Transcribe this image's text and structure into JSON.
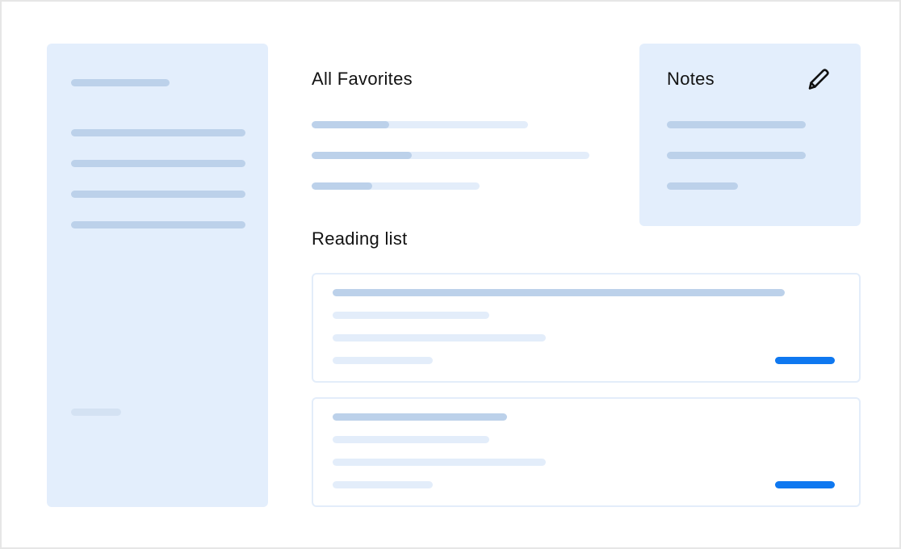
{
  "favorites": {
    "title": "All Favorites",
    "items": [
      {
        "progress": 0.36
      },
      {
        "progress": 0.36
      },
      {
        "progress": 0.36
      }
    ]
  },
  "reading_list": {
    "title": "Reading list"
  },
  "notes": {
    "title": "Notes",
    "edit_icon": "pencil-icon"
  },
  "colors": {
    "panel": "#e3eefc",
    "placeholder_dark": "#bcd1ea",
    "placeholder_light": "#e3edfa",
    "accent": "#0f78f0"
  }
}
